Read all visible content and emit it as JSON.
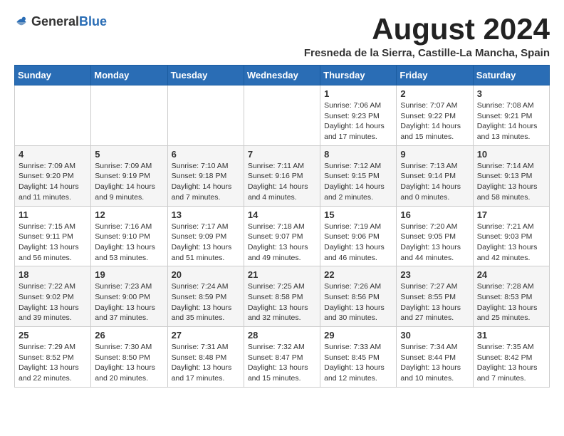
{
  "header": {
    "logo_general": "General",
    "logo_blue": "Blue",
    "month_title": "August 2024",
    "location": "Fresneda de la Sierra, Castille-La Mancha, Spain"
  },
  "weekdays": [
    "Sunday",
    "Monday",
    "Tuesday",
    "Wednesday",
    "Thursday",
    "Friday",
    "Saturday"
  ],
  "weeks": [
    [
      {
        "day": "",
        "info": ""
      },
      {
        "day": "",
        "info": ""
      },
      {
        "day": "",
        "info": ""
      },
      {
        "day": "",
        "info": ""
      },
      {
        "day": "1",
        "info": "Sunrise: 7:06 AM\nSunset: 9:23 PM\nDaylight: 14 hours\nand 17 minutes."
      },
      {
        "day": "2",
        "info": "Sunrise: 7:07 AM\nSunset: 9:22 PM\nDaylight: 14 hours\nand 15 minutes."
      },
      {
        "day": "3",
        "info": "Sunrise: 7:08 AM\nSunset: 9:21 PM\nDaylight: 14 hours\nand 13 minutes."
      }
    ],
    [
      {
        "day": "4",
        "info": "Sunrise: 7:09 AM\nSunset: 9:20 PM\nDaylight: 14 hours\nand 11 minutes."
      },
      {
        "day": "5",
        "info": "Sunrise: 7:09 AM\nSunset: 9:19 PM\nDaylight: 14 hours\nand 9 minutes."
      },
      {
        "day": "6",
        "info": "Sunrise: 7:10 AM\nSunset: 9:18 PM\nDaylight: 14 hours\nand 7 minutes."
      },
      {
        "day": "7",
        "info": "Sunrise: 7:11 AM\nSunset: 9:16 PM\nDaylight: 14 hours\nand 4 minutes."
      },
      {
        "day": "8",
        "info": "Sunrise: 7:12 AM\nSunset: 9:15 PM\nDaylight: 14 hours\nand 2 minutes."
      },
      {
        "day": "9",
        "info": "Sunrise: 7:13 AM\nSunset: 9:14 PM\nDaylight: 14 hours\nand 0 minutes."
      },
      {
        "day": "10",
        "info": "Sunrise: 7:14 AM\nSunset: 9:13 PM\nDaylight: 13 hours\nand 58 minutes."
      }
    ],
    [
      {
        "day": "11",
        "info": "Sunrise: 7:15 AM\nSunset: 9:11 PM\nDaylight: 13 hours\nand 56 minutes."
      },
      {
        "day": "12",
        "info": "Sunrise: 7:16 AM\nSunset: 9:10 PM\nDaylight: 13 hours\nand 53 minutes."
      },
      {
        "day": "13",
        "info": "Sunrise: 7:17 AM\nSunset: 9:09 PM\nDaylight: 13 hours\nand 51 minutes."
      },
      {
        "day": "14",
        "info": "Sunrise: 7:18 AM\nSunset: 9:07 PM\nDaylight: 13 hours\nand 49 minutes."
      },
      {
        "day": "15",
        "info": "Sunrise: 7:19 AM\nSunset: 9:06 PM\nDaylight: 13 hours\nand 46 minutes."
      },
      {
        "day": "16",
        "info": "Sunrise: 7:20 AM\nSunset: 9:05 PM\nDaylight: 13 hours\nand 44 minutes."
      },
      {
        "day": "17",
        "info": "Sunrise: 7:21 AM\nSunset: 9:03 PM\nDaylight: 13 hours\nand 42 minutes."
      }
    ],
    [
      {
        "day": "18",
        "info": "Sunrise: 7:22 AM\nSunset: 9:02 PM\nDaylight: 13 hours\nand 39 minutes."
      },
      {
        "day": "19",
        "info": "Sunrise: 7:23 AM\nSunset: 9:00 PM\nDaylight: 13 hours\nand 37 minutes."
      },
      {
        "day": "20",
        "info": "Sunrise: 7:24 AM\nSunset: 8:59 PM\nDaylight: 13 hours\nand 35 minutes."
      },
      {
        "day": "21",
        "info": "Sunrise: 7:25 AM\nSunset: 8:58 PM\nDaylight: 13 hours\nand 32 minutes."
      },
      {
        "day": "22",
        "info": "Sunrise: 7:26 AM\nSunset: 8:56 PM\nDaylight: 13 hours\nand 30 minutes."
      },
      {
        "day": "23",
        "info": "Sunrise: 7:27 AM\nSunset: 8:55 PM\nDaylight: 13 hours\nand 27 minutes."
      },
      {
        "day": "24",
        "info": "Sunrise: 7:28 AM\nSunset: 8:53 PM\nDaylight: 13 hours\nand 25 minutes."
      }
    ],
    [
      {
        "day": "25",
        "info": "Sunrise: 7:29 AM\nSunset: 8:52 PM\nDaylight: 13 hours\nand 22 minutes."
      },
      {
        "day": "26",
        "info": "Sunrise: 7:30 AM\nSunset: 8:50 PM\nDaylight: 13 hours\nand 20 minutes."
      },
      {
        "day": "27",
        "info": "Sunrise: 7:31 AM\nSunset: 8:48 PM\nDaylight: 13 hours\nand 17 minutes."
      },
      {
        "day": "28",
        "info": "Sunrise: 7:32 AM\nSunset: 8:47 PM\nDaylight: 13 hours\nand 15 minutes."
      },
      {
        "day": "29",
        "info": "Sunrise: 7:33 AM\nSunset: 8:45 PM\nDaylight: 13 hours\nand 12 minutes."
      },
      {
        "day": "30",
        "info": "Sunrise: 7:34 AM\nSunset: 8:44 PM\nDaylight: 13 hours\nand 10 minutes."
      },
      {
        "day": "31",
        "info": "Sunrise: 7:35 AM\nSunset: 8:42 PM\nDaylight: 13 hours\nand 7 minutes."
      }
    ]
  ]
}
